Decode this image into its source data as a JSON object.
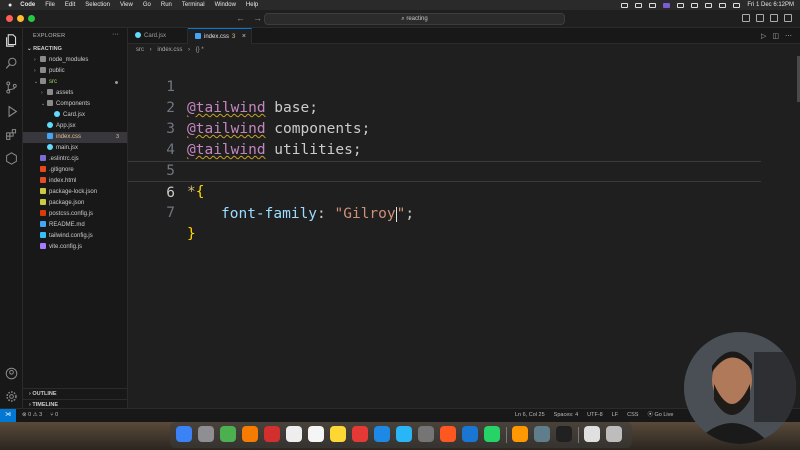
{
  "menubar": {
    "apple": "",
    "items": [
      "Code",
      "File",
      "Edit",
      "Selection",
      "View",
      "Go",
      "Run",
      "Terminal",
      "Window",
      "Help"
    ],
    "clock": "Fri 1 Dec 6:12PM"
  },
  "titlebar": {
    "search_text": "reacting",
    "nav_back": "←",
    "nav_forward": "→"
  },
  "explorer": {
    "header": "EXPLORER",
    "more": "···",
    "project": "REACTING",
    "tree": [
      {
        "label": "node_modules",
        "kind": "folder",
        "open": false,
        "indent": 1
      },
      {
        "label": "public",
        "kind": "folder",
        "open": false,
        "indent": 1
      },
      {
        "label": "src",
        "kind": "folder",
        "open": true,
        "indent": 1,
        "color": "#a5d36b"
      },
      {
        "label": "assets",
        "kind": "folder",
        "open": false,
        "indent": 2
      },
      {
        "label": "Components",
        "kind": "folder",
        "open": true,
        "indent": 2
      },
      {
        "label": "Card.jsx",
        "kind": "react",
        "indent": 3
      },
      {
        "label": "App.jsx",
        "kind": "react",
        "indent": 2
      },
      {
        "label": "index.css",
        "kind": "css",
        "indent": 2,
        "badge": "3",
        "color": "#e2c08d"
      },
      {
        "label": "main.jsx",
        "kind": "react",
        "indent": 2
      },
      {
        "label": ".eslintrc.cjs",
        "kind": "eslint",
        "indent": 1
      },
      {
        "label": ".gitignore",
        "kind": "git",
        "indent": 1
      },
      {
        "label": "index.html",
        "kind": "html",
        "indent": 1
      },
      {
        "label": "package-lock.json",
        "kind": "json",
        "indent": 1
      },
      {
        "label": "package.json",
        "kind": "json",
        "indent": 1
      },
      {
        "label": "postcss.config.js",
        "kind": "postcss",
        "indent": 1
      },
      {
        "label": "README.md",
        "kind": "md",
        "indent": 1
      },
      {
        "label": "tailwind.config.js",
        "kind": "tailwind",
        "indent": 1
      },
      {
        "label": "vite.config.js",
        "kind": "vite",
        "indent": 1
      }
    ],
    "outline": "OUTLINE",
    "timeline": "TIMELINE"
  },
  "tabs": [
    {
      "label": "Card.jsx",
      "active": false
    },
    {
      "label": "index.css",
      "active": true,
      "badge": "3",
      "close": "×"
    }
  ],
  "breadcrumbs": [
    "src",
    "›",
    "index.css",
    "›",
    "{} *"
  ],
  "editor": {
    "lines": [
      {
        "n": "1",
        "kw": "@tailwind",
        "rest": " base;"
      },
      {
        "n": "2",
        "kw": "@tailwind",
        "rest": " components;"
      },
      {
        "n": "3",
        "kw": "@tailwind",
        "rest": " utilities;"
      },
      {
        "n": "4"
      },
      {
        "n": "5",
        "sel": "*",
        "open": "{"
      },
      {
        "n": "6",
        "prop": "font-family",
        "colon": ": ",
        "str1": "\"Gilroy",
        "str2": "\"",
        "semi": ";"
      },
      {
        "n": "7",
        "close": "}"
      }
    ]
  },
  "status": {
    "remote": "⋊",
    "problems": "⊗ 0 ⚠ 3",
    "ports": "⑂ 0",
    "position": "Ln 6, Col 25",
    "spaces": "Spaces: 4",
    "encoding": "UTF-8",
    "eol": "LF",
    "language": "CSS",
    "golive": "⦿ Go Live"
  },
  "colors": {
    "accent": "#0078d4",
    "keyword": "#c586c0",
    "brace": "#ffd700",
    "property": "#9cdcfe",
    "string": "#ce9178"
  }
}
